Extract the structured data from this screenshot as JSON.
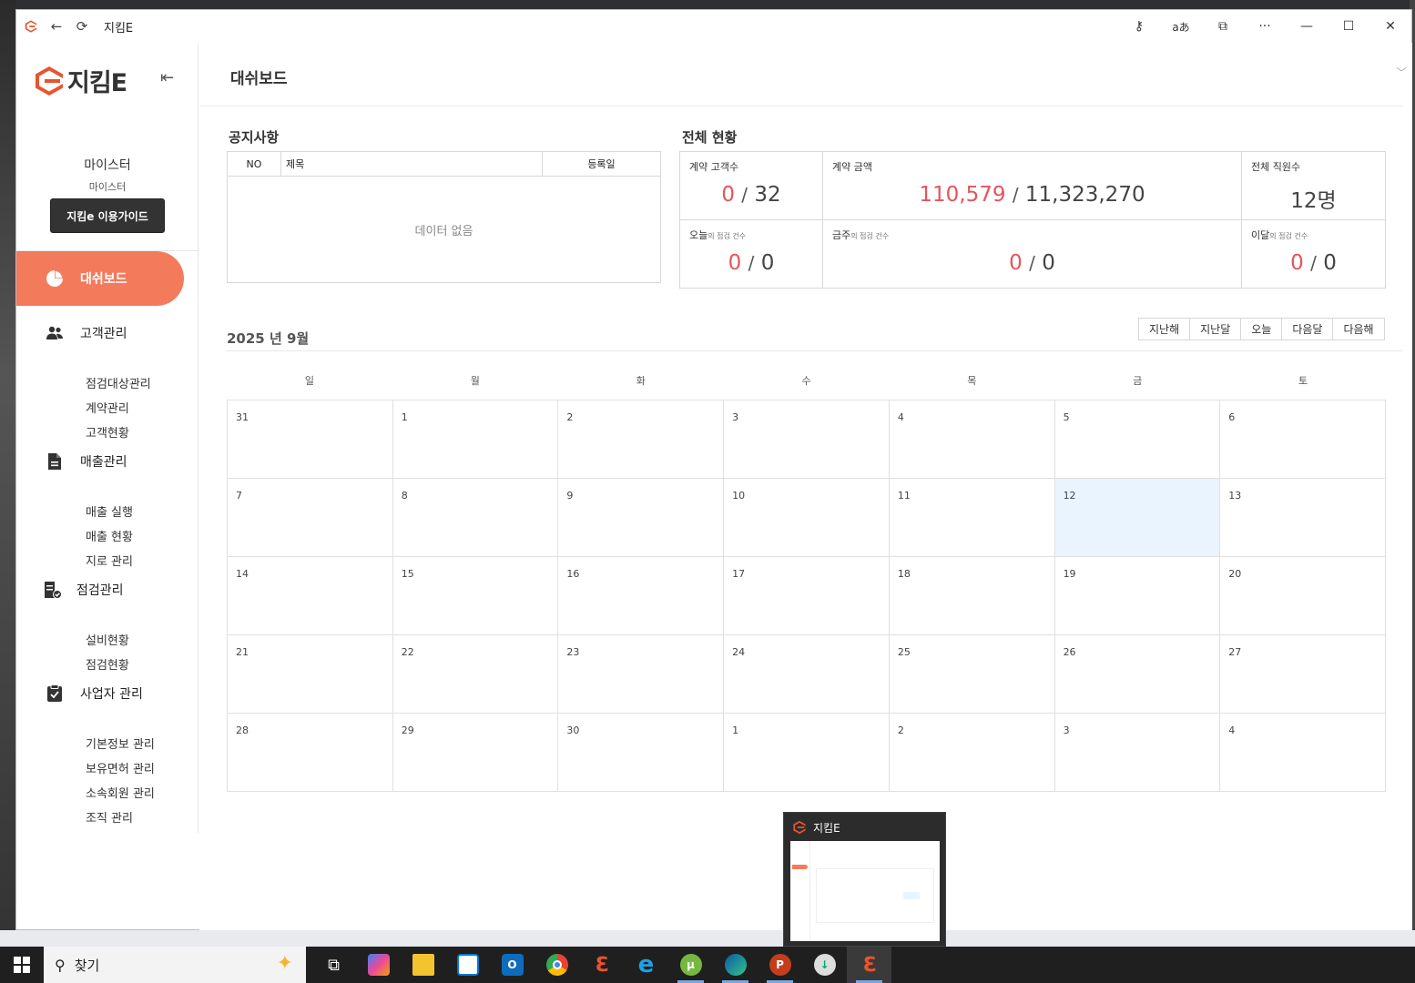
{
  "window": {
    "title": "지킴E"
  },
  "sidebar": {
    "logo_text": "지킴E",
    "user_name": "마이스터",
    "user_role": "마이스터",
    "guide_button": "지킴e 이용가이드",
    "active_item": "대쉬보드",
    "groups": [
      {
        "label": "고객관리",
        "icon": "people-icon",
        "items": [
          "점검대상관리",
          "계약관리",
          "고객현황"
        ]
      },
      {
        "label": "매출관리",
        "icon": "document-icon",
        "items": [
          "매출 실행",
          "매출 현황",
          "지로 관리"
        ]
      },
      {
        "label": "점검관리",
        "icon": "checklist-icon",
        "items": [
          "설비현황",
          "점검현황"
        ]
      },
      {
        "label": "사업자 관리",
        "icon": "clipboard-icon",
        "items": [
          "기본정보 관리",
          "보유면허 관리",
          "소속회원 관리",
          "조직 관리"
        ]
      }
    ]
  },
  "main": {
    "title": "대쉬보드",
    "notice": {
      "title": "공지사항",
      "col_no": "NO",
      "col_title": "제목",
      "col_date": "등록일",
      "empty": "데이터 없음"
    },
    "stats": {
      "title": "전체 현황",
      "contract_customers": {
        "label": "계약 고객수",
        "value": "0",
        "total": "32"
      },
      "contract_amount": {
        "label": "계약 금액",
        "value": "110,579",
        "total": "11,323,270"
      },
      "employees": {
        "label": "전체 직원수",
        "value": "12명"
      },
      "today": {
        "label": "오늘",
        "small": "의 점검 건수",
        "value": "0",
        "total": "0"
      },
      "week": {
        "label": "금주",
        "small": "의 점검 건수",
        "value": "0",
        "total": "0"
      },
      "month": {
        "label": "이달",
        "small": "의 점검 건수",
        "value": "0",
        "total": "0"
      },
      "separator": "/"
    },
    "calendar": {
      "title": "2025 년 9월",
      "buttons": [
        "지난해",
        "지난달",
        "오늘",
        "다음달",
        "다음해"
      ],
      "weekdays": [
        "일",
        "월",
        "화",
        "수",
        "목",
        "금",
        "토"
      ],
      "days": [
        "31",
        "1",
        "2",
        "3",
        "4",
        "5",
        "6",
        "7",
        "8",
        "9",
        "10",
        "11",
        "12",
        "13",
        "14",
        "15",
        "16",
        "17",
        "18",
        "19",
        "20",
        "21",
        "22",
        "23",
        "24",
        "25",
        "26",
        "27",
        "28",
        "29",
        "30",
        "1",
        "2",
        "3",
        "4"
      ],
      "today_index": 12
    }
  },
  "taskbar": {
    "search_placeholder": "찾기",
    "preview_title": "지킴E"
  },
  "colors": {
    "accent": "#f47a5c",
    "highlight_red": "#e5555a",
    "today_bg": "#eaf4fe"
  }
}
